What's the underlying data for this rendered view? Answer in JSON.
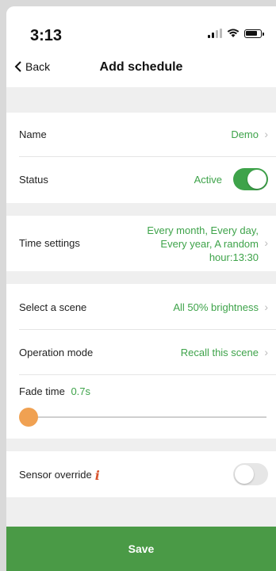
{
  "status_bar": {
    "time": "3:13"
  },
  "nav": {
    "back_label": "Back",
    "title": "Add schedule"
  },
  "rows": {
    "name": {
      "label": "Name",
      "value": "Demo"
    },
    "status": {
      "label": "Status",
      "value": "Active",
      "toggle_on": true
    },
    "time_settings": {
      "label": "Time settings",
      "value_line1": "Every month, Every day,",
      "value_line2": "Every year, A random",
      "value_line3": "hour:13:30"
    },
    "scene": {
      "label": "Select a scene",
      "value": "All 50% brightness"
    },
    "operation_mode": {
      "label": "Operation mode",
      "value": "Recall this scene"
    },
    "fade_time": {
      "label": "Fade time",
      "value": "0.7s",
      "slider_fraction": 0.0
    },
    "sensor_override": {
      "label": "Sensor override",
      "toggle_on": false
    }
  },
  "save_label": "Save",
  "colors": {
    "accent": "#3ea34a",
    "save_bg": "#4a9a46",
    "slider_thumb": "#f0a152",
    "info_icon": "#d8552f"
  }
}
